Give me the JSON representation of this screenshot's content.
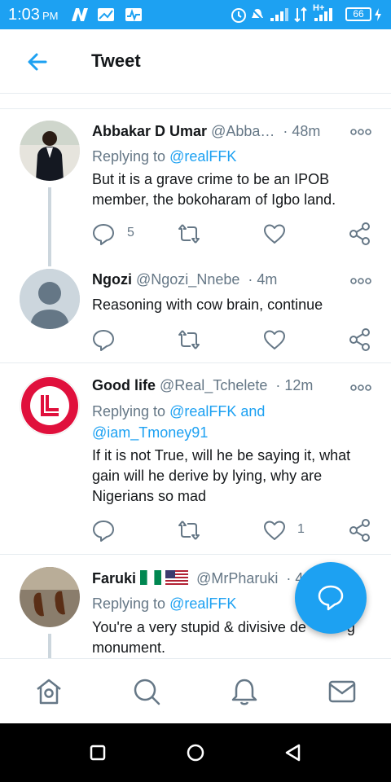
{
  "status_bar": {
    "time": "1:03",
    "ampm": "PM",
    "network": "H+",
    "battery": "66"
  },
  "header": {
    "title": "Tweet"
  },
  "tweets": [
    {
      "name": "Abbakar D Umar",
      "handle": "@Abba…",
      "time": "· 48m",
      "reply_prefix": "Replying to ",
      "reply_to": "@realFFK",
      "text": "But it is a grave crime to be an IPOB member, the bokoharam of Igbo land.",
      "reply_count": "5",
      "like_count": ""
    },
    {
      "name": "Ngozi",
      "handle": "@Ngozi_Nnebe",
      "time": "· 4m",
      "text": "Reasoning with cow brain, continue",
      "reply_count": "",
      "like_count": ""
    },
    {
      "name": "Good life",
      "handle": "@Real_Tchelete",
      "time": "· 12m",
      "reply_prefix": "Replying to ",
      "reply_to": "@realFFK and",
      "reply_to_2": "@iam_Tmoney91",
      "text": "If it is not True, will he be saying it, what gain will he derive  by lying, why are Nigerians so mad",
      "reply_count": "",
      "like_count": "1"
    },
    {
      "name": "Faruki",
      "handle": "@MrPharuki",
      "time": "· 4",
      "reply_prefix": "Replying to ",
      "reply_to": "@realFFK",
      "text": "You're a very stupid & divisive de          g monument."
    }
  ],
  "colors": {
    "accent": "#1da1f2",
    "text": "#14171a",
    "muted": "#657786",
    "divider": "#e6ecf0"
  },
  "icons": [
    "back-arrow-icon",
    "more-icon",
    "reply-icon",
    "retweet-icon",
    "like-icon",
    "share-icon",
    "compose-icon",
    "home-icon",
    "search-icon",
    "notifications-icon",
    "messages-icon"
  ]
}
